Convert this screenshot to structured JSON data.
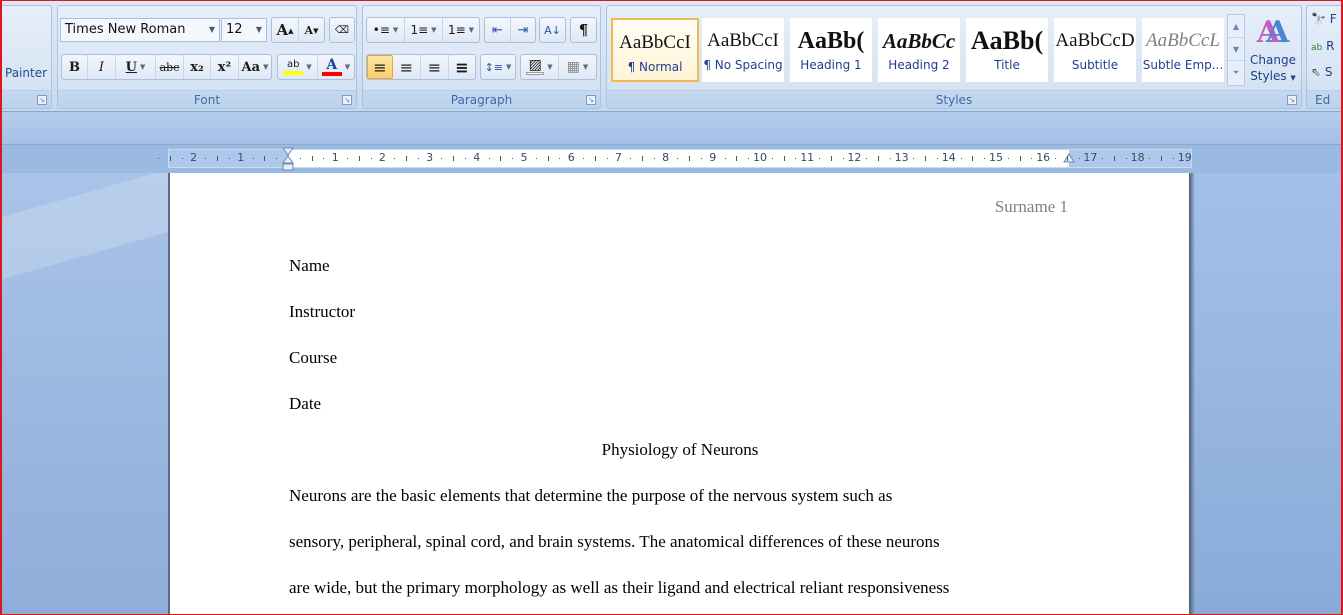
{
  "ribbon": {
    "clipboard": {
      "format_painter_label": "Painter"
    },
    "font": {
      "group_label": "Font",
      "font_name": "Times New Roman",
      "font_size": "12",
      "grow_font": "A",
      "shrink_font": "A",
      "clear_formatting": "Ä",
      "bold": "B",
      "italic": "I",
      "underline": "U",
      "strikethrough": "abc",
      "subscript": "x₂",
      "superscript": "x²",
      "change_case": "Aa",
      "highlight": "ab",
      "font_color": "A",
      "highlight_color": "#ffff00",
      "font_color_value": "#ff0000"
    },
    "paragraph": {
      "group_label": "Paragraph",
      "bullets": "•≡",
      "numbering": "1≡",
      "multilevel": "1≡",
      "decrease_indent": "⇤",
      "increase_indent": "⇥",
      "sort": "A↓",
      "show_marks": "¶",
      "align_left": "≡",
      "align_center": "≡",
      "align_right": "≡",
      "justify": "≡",
      "line_spacing": "↕≡",
      "shading": "▨",
      "borders": "▦"
    },
    "styles": {
      "group_label": "Styles",
      "items": [
        {
          "sample": "AaBbCcI",
          "name": "¶ Normal",
          "selected": true
        },
        {
          "sample": "AaBbCcI",
          "name": "¶ No Spacing",
          "selected": false
        },
        {
          "sample": "AaBb(",
          "name": "Heading 1",
          "selected": false
        },
        {
          "sample": "AaBbCc",
          "name": "Heading 2",
          "selected": false
        },
        {
          "sample": "AaBb(",
          "name": "Title",
          "selected": false
        },
        {
          "sample": "AaBbCcD",
          "name": "Subtitle",
          "selected": false
        },
        {
          "sample": "AaBbCcL",
          "name": "Subtle Emp...",
          "selected": false
        }
      ],
      "change_styles_line1": "Change",
      "change_styles_line2": "Styles"
    },
    "editing": {
      "group_label": "Ed",
      "find": "F",
      "replace": "R",
      "select": "S"
    }
  },
  "ruler": {
    "left_numbers": [
      "2",
      "1"
    ],
    "right_numbers": [
      "1",
      "2",
      "3",
      "4",
      "5",
      "6",
      "7",
      "8",
      "9",
      "10",
      "11",
      "12",
      "13",
      "14",
      "15",
      "16",
      "17",
      "18",
      "19"
    ]
  },
  "document": {
    "header": "Surname 1",
    "lines": [
      "Name",
      "Instructor",
      "Course",
      "Date"
    ],
    "title": "Physiology of Neurons",
    "body_lines": [
      "Neurons are the basic elements that determine the purpose of the nervous system such as",
      "sensory, peripheral, spinal cord, and brain systems. The anatomical differences of these neurons",
      "are wide, but the primary morphology as well as their ligand and electrical reliant responsiveness"
    ]
  }
}
